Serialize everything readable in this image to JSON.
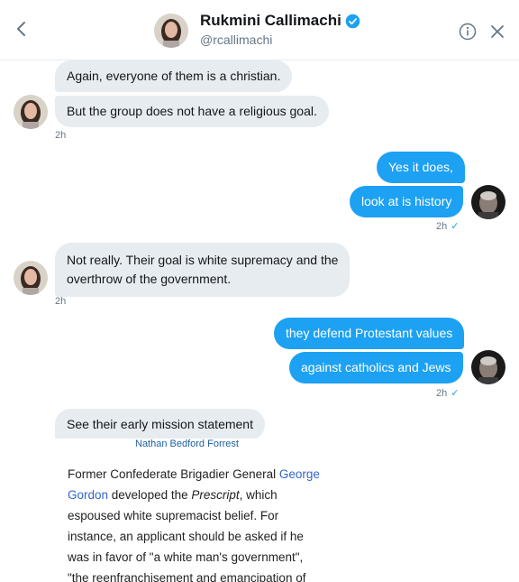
{
  "header": {
    "name": "Rukmini Callimachi",
    "handle": "@rcallimachi",
    "back_icon": "chevron-left-icon",
    "info_icon": "info-icon",
    "close_icon": "close-icon",
    "verified_icon": "verified-badge-icon"
  },
  "messages": [
    {
      "side": "in",
      "text": "Again, everyone of them is a christian."
    },
    {
      "side": "in",
      "text": "But the group does not have a religious goal."
    },
    {
      "side": "out",
      "text": "Yes it does,"
    },
    {
      "side": "out",
      "text": "look at is history"
    },
    {
      "side": "in",
      "line1": "Not really. Their goal is white supremacy and the",
      "line2": "overthrow of the government."
    },
    {
      "side": "out",
      "text": "they defend Protestant values"
    },
    {
      "side": "out",
      "text": "against catholics and Jews"
    },
    {
      "side": "in",
      "text": "See their early mission statement"
    }
  ],
  "timestamps": {
    "t1": "2h",
    "t2": "2h",
    "t3": "2h",
    "t4": "2h",
    "check": "✓"
  },
  "card": {
    "link_text": "Nathan Bedford Forrest",
    "p1": "Former Confederate Brigadier General ",
    "link2": "George Gordon",
    "p2": " developed the ",
    "italic": "Prescript",
    "p3": ", which",
    "line3": "espoused white supremacist belief. For",
    "line4": "instance, an applicant should be asked if he",
    "line5": "was in favor of \"a white man's government\",",
    "line6": "\"the reenfranchisement and emancipation of"
  },
  "colors": {
    "accent": "#1da1f2",
    "incoming_bubble": "#e6ecf0",
    "muted_text": "#657786"
  }
}
